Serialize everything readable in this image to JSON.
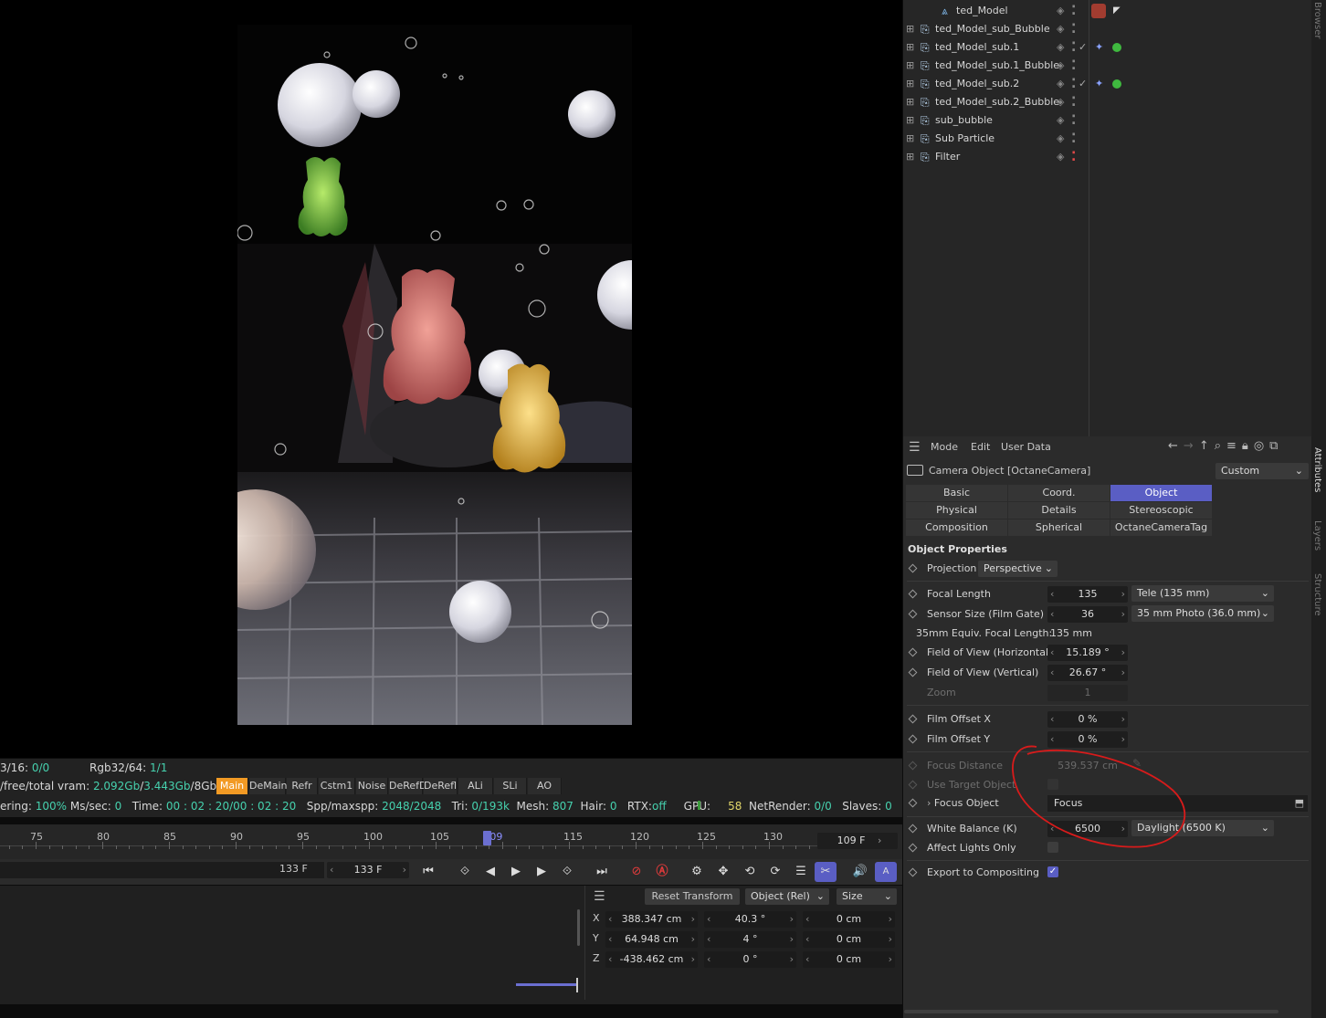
{
  "objects": [
    {
      "label": "ted_Model",
      "indent": true,
      "extra": "model"
    },
    {
      "label": "ted_Model_sub_Bubble",
      "extra": ""
    },
    {
      "label": "ted_Model_sub.1",
      "extra": "check"
    },
    {
      "label": "ted_Model_sub.1_Bubble",
      "extra": ""
    },
    {
      "label": "ted_Model_sub.2",
      "extra": "check"
    },
    {
      "label": "ted_Model_sub.2_Bubble",
      "extra": ""
    },
    {
      "label": "sub_bubble",
      "extra": ""
    },
    {
      "label": "Sub Particle",
      "extra": ""
    },
    {
      "label": "Filter",
      "extra": "red"
    }
  ],
  "sidebar": {
    "browser": "Browser",
    "attributes": "Attributes",
    "layers": "Layers",
    "structure": "Structure"
  },
  "attr": {
    "menu": {
      "mode": "Mode",
      "edit": "Edit",
      "userdata": "User Data"
    },
    "object_title": "Camera Object [OctaneCamera]",
    "preset": "Custom",
    "tabs": [
      {
        "label": "Basic",
        "sel": false
      },
      {
        "label": "Coord.",
        "sel": false
      },
      {
        "label": "Object",
        "sel": true
      },
      {
        "label": "Physical",
        "sel": false
      },
      {
        "label": "Details",
        "sel": false
      },
      {
        "label": "Stereoscopic",
        "sel": false
      },
      {
        "label": "Composition",
        "sel": false
      },
      {
        "label": "Spherical",
        "sel": false
      },
      {
        "label": "OctaneCameraTag",
        "sel": false
      }
    ],
    "section": "Object Properties",
    "projection_label": "Projection",
    "projection_value": "Perspective",
    "focal_label": "Focal Length",
    "focal_value": "135",
    "focal_preset": "Tele (135 mm)",
    "sensor_label": "Sensor Size (Film Gate)",
    "sensor_value": "36",
    "sensor_preset": "35 mm Photo (36.0 mm)",
    "equiv_label": "35mm Equiv. Focal Length:",
    "equiv_value": "135 mm",
    "fovh_label": "Field of View (Horizontal)",
    "fovh_value": "15.189 °",
    "fovv_label": "Field of View (Vertical)",
    "fovv_value": "26.67 °",
    "zoom_label": "Zoom",
    "zoom_value": "1",
    "offx_label": "Film Offset X",
    "offx_value": "0 %",
    "offy_label": "Film Offset Y",
    "offy_value": "0 %",
    "focusdist_label": "Focus Distance",
    "focusdist_value": "539.537 cm",
    "usetarget_label": "Use Target Object",
    "focusobj_label": "Focus Object",
    "focusobj_value": "Focus",
    "wb_label": "White Balance (K)",
    "wb_value": "6500",
    "wb_preset": "Daylight (6500 K)",
    "affect_label": "Affect Lights Only",
    "export_label": "Export to Compositing"
  },
  "status": {
    "r1a": "3/16: ",
    "r1a_v": "0/0",
    "r1b": "Rgb32/64: ",
    "r1b_v": "1/1",
    "r2a": "/free/total vram: ",
    "r2a_v1": "2.092Gb",
    "r2a_s1": "/",
    "r2a_v2": "3.443Gb",
    "r2a_s2": "/8Gb",
    "r3": [
      {
        "t": "ering: ",
        "v": "100%"
      },
      {
        "t": " Ms/sec: ",
        "v": "0"
      },
      {
        "t": "   Time: ",
        "v": "00 : 02 : 20/00 : 02 : 20"
      },
      {
        "t": "   Spp/maxspp: ",
        "v": "2048/2048"
      },
      {
        "t": "   Tri: ",
        "v": "0/193k"
      },
      {
        "t": "  Mesh: ",
        "v": "807"
      },
      {
        "t": "  Hair: ",
        "v": "0"
      },
      {
        "t": "   RTX:",
        "v": "off"
      },
      {
        "t": "     GPU: ",
        "v": ""
      },
      {
        "t": "    ",
        "v": "58"
      },
      {
        "t": "  NetRender: ",
        "v": "0/0"
      },
      {
        "t": "   Slaves: ",
        "v": "0"
      }
    ]
  },
  "channels": [
    "Main",
    "DeMain",
    "Refr",
    "Cstm1",
    "Noise",
    "DeRefD",
    "DeRefl",
    "ALi",
    "SLi",
    "AO"
  ],
  "timeline": {
    "ticks": [
      "75",
      "80",
      "85",
      "90",
      "95",
      "100",
      "105",
      "109",
      "115",
      "120",
      "125",
      "130"
    ],
    "current_frame": 109,
    "frame_field": "109 F"
  },
  "transport": {
    "end_frame": "133 F",
    "end_field": "133 F"
  },
  "coord": {
    "reset": "Reset Transform",
    "mode": "Object (Rel)",
    "size": "Size",
    "rows": [
      {
        "axis": "X",
        "pos": "388.347 cm",
        "rot": "40.3 °",
        "size": "0 cm"
      },
      {
        "axis": "Y",
        "pos": "64.948 cm",
        "rot": "4 °",
        "size": "0 cm"
      },
      {
        "axis": "Z",
        "pos": "-438.462 cm",
        "rot": "0 °",
        "size": "0 cm"
      }
    ]
  },
  "colors": {
    "accent": "#5a5ec4",
    "orange": "#f29a24",
    "teal": "#46d1ae",
    "annotation": "#d81b1b"
  }
}
